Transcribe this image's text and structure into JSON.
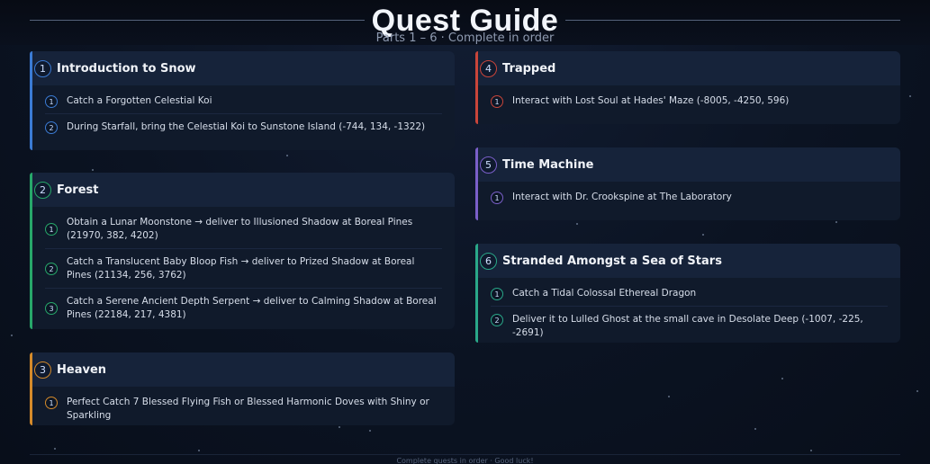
{
  "header": {
    "title": "Quest Guide",
    "subtitle": "Parts 1 – 6 · Complete in order"
  },
  "colors": {
    "blue": "#3b7bd4",
    "green": "#27a86a",
    "orange": "#d48a2a",
    "red": "#c9453a",
    "purple": "#7a5fc9",
    "teal": "#2aa889"
  },
  "quests": [
    {
      "number": "1",
      "title": "Introduction to Snow",
      "color": "#3b7bd4",
      "steps": [
        {
          "n": "1",
          "text": "Catch a Forgotten Celestial Koi"
        },
        {
          "n": "2",
          "text": "During Starfall, bring the Celestial Koi to Sunstone Island (-744, 134, -1322)"
        }
      ]
    },
    {
      "number": "2",
      "title": "Forest",
      "color": "#27a86a",
      "steps": [
        {
          "n": "1",
          "text": "Obtain a Lunar Moonstone → deliver to Illusioned Shadow at Boreal Pines (21970, 382, 4202)"
        },
        {
          "n": "2",
          "text": "Catch a Translucent Baby Bloop Fish → deliver to Prized Shadow at Boreal Pines (21134, 256, 3762)"
        },
        {
          "n": "3",
          "text": "Catch a Serene Ancient Depth Serpent → deliver to Calming Shadow at Boreal Pines (22184, 217, 4381)"
        }
      ]
    },
    {
      "number": "3",
      "title": "Heaven",
      "color": "#d48a2a",
      "steps": [
        {
          "n": "1",
          "text": "Perfect Catch 7 Blessed Flying Fish or Blessed Harmonic Doves with Shiny or Sparkling"
        }
      ]
    },
    {
      "number": "4",
      "title": "Trapped",
      "color": "#c9453a",
      "steps": [
        {
          "n": "1",
          "text": "Interact with Lost Soul at Hades' Maze (-8005, -4250, 596)"
        }
      ]
    },
    {
      "number": "5",
      "title": "Time Machine",
      "color": "#7a5fc9",
      "steps": [
        {
          "n": "1",
          "text": "Interact with Dr. Crookspine at The Laboratory"
        }
      ]
    },
    {
      "number": "6",
      "title": "Stranded Amongst a Sea of Stars",
      "color": "#2aa889",
      "steps": [
        {
          "n": "1",
          "text": "Catch a Tidal Colossal Ethereal Dragon"
        },
        {
          "n": "2",
          "text": "Deliver it to Lulled Ghost at the small cave in Desolate Deep (-1007, -225, -2691)"
        }
      ]
    }
  ],
  "footer": {
    "text": "Complete quests in order · Good luck!"
  }
}
